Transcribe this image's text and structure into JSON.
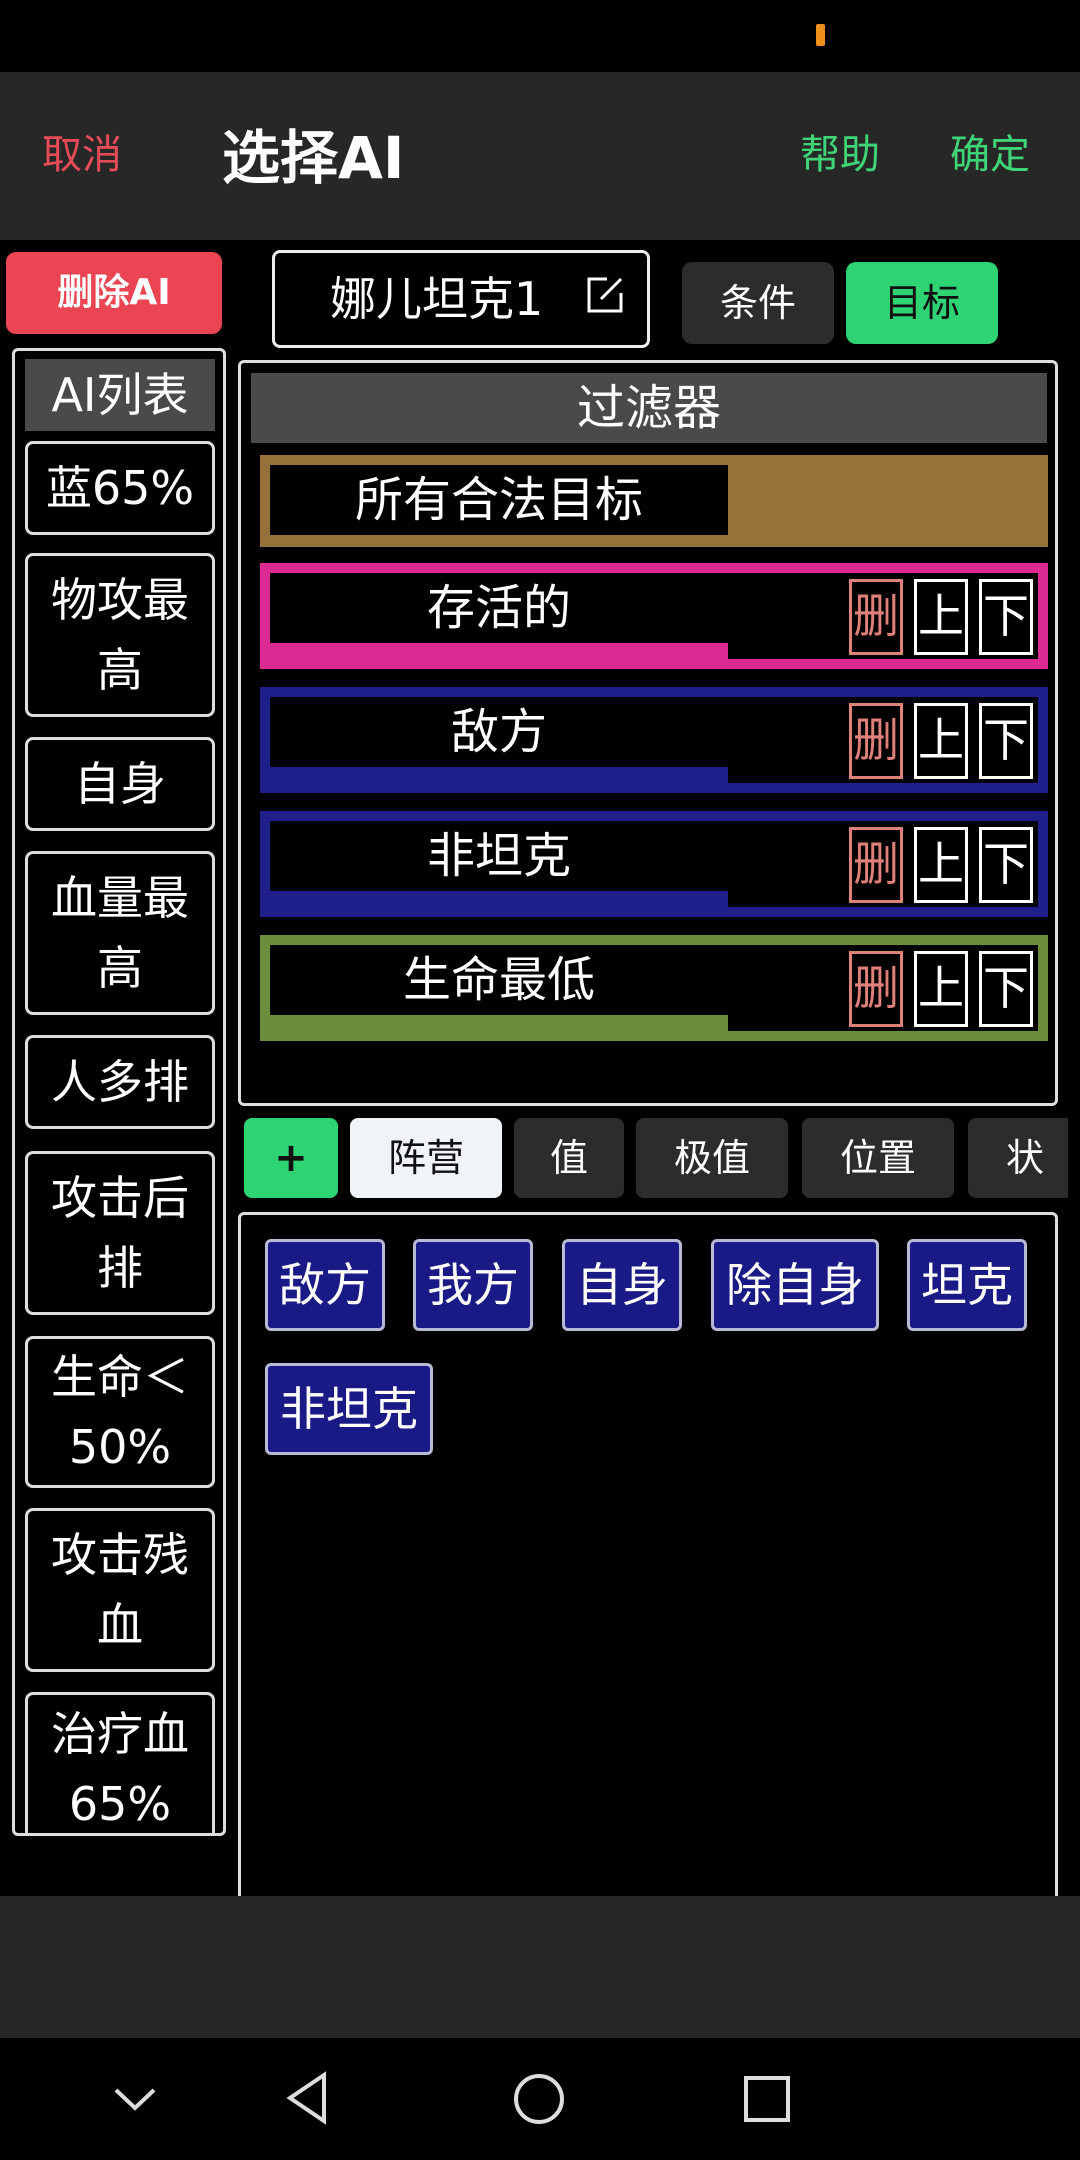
{
  "header": {
    "cancel": "取消",
    "title": "选择AI",
    "help": "帮助",
    "confirm": "确定"
  },
  "sidebar": {
    "delete_label": "删除AI",
    "list_title": "AI列表",
    "items": [
      {
        "label": "蓝65%"
      },
      {
        "label": "物攻最高"
      },
      {
        "label": "自身"
      },
      {
        "label": "血量最高"
      },
      {
        "label": "人多排"
      },
      {
        "label": "攻击后排"
      },
      {
        "label": "生命＜50%"
      },
      {
        "label": "攻击残血"
      },
      {
        "label": "治疗血65%"
      }
    ]
  },
  "editor": {
    "name": "娜儿坦克1"
  },
  "tabs": {
    "condition": "条件",
    "target": "目标"
  },
  "filter": {
    "title": "过滤器",
    "rows": [
      {
        "label": "所有合法目标",
        "color": "#94723a"
      },
      {
        "label": "存活的",
        "color": "#dd2a92"
      },
      {
        "label": "敌方",
        "color": "#1e1f8a"
      },
      {
        "label": "非坦克",
        "color": "#1e1f8a"
      },
      {
        "label": "生命最低",
        "color": "#6c8e3a"
      }
    ],
    "delete_label": "删",
    "up_label": "上",
    "down_label": "下"
  },
  "categories": {
    "add": "+",
    "items": [
      "阵营",
      "值",
      "极值",
      "位置",
      "状态"
    ]
  },
  "options": [
    "敌方",
    "我方",
    "自身",
    "除自身",
    "坦克",
    "非坦克"
  ],
  "colors": {
    "accent_green": "#2ed374",
    "danger_red": "#eb4553",
    "option_blue": "#1a1a86"
  }
}
